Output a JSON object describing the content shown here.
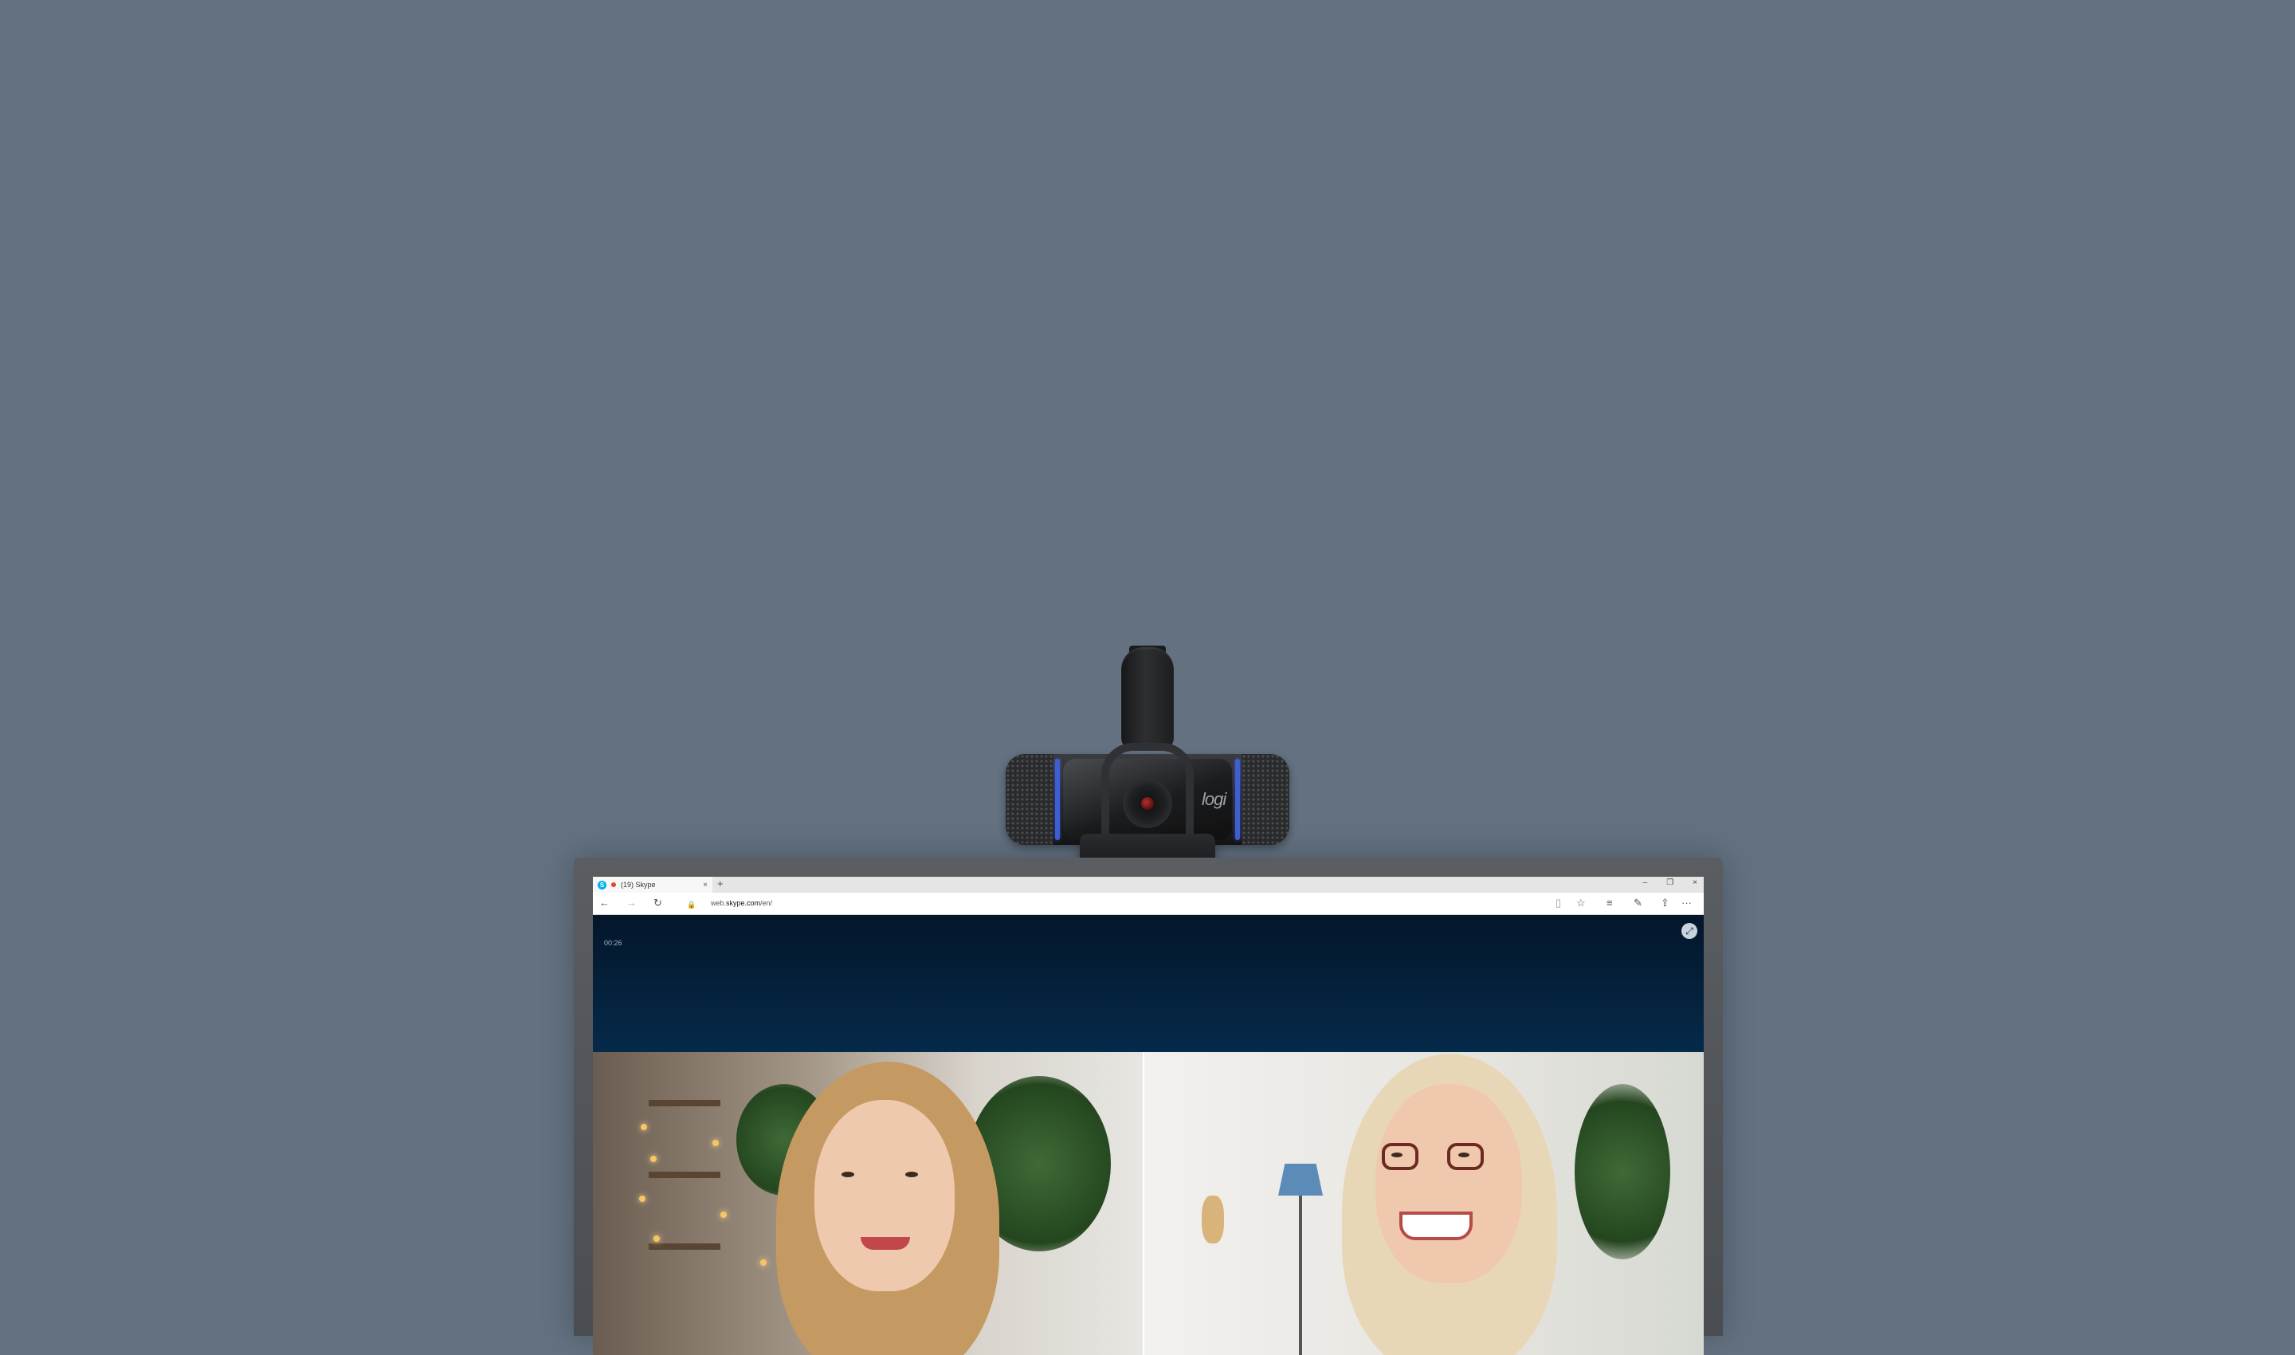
{
  "browser": {
    "tab_title": "(19) Skype",
    "tab_icon_letter": "S",
    "tab_close": "×",
    "new_tab": "+",
    "window_controls": {
      "minimize": "–",
      "restore": "❐",
      "close": "×"
    },
    "address_prefix": "web.",
    "address_domain": "skype.com",
    "address_suffix": "/en/"
  },
  "toolbar_icons": {
    "back": "←",
    "forward": "→",
    "refresh": "↻",
    "lock": "🔒",
    "reading_view": "▯",
    "favorite": "☆",
    "hub": "≡",
    "notes": "✎",
    "share": "⇪",
    "more": "···"
  },
  "call": {
    "timer": "00:26",
    "fullscreen_icon": "⤢"
  },
  "webcam": {
    "logo": "logi"
  },
  "colors": {
    "background": "#637180",
    "call_header": "#052a4a",
    "accent_blue": "#3e5fd4",
    "skype_blue": "#00aff0"
  }
}
